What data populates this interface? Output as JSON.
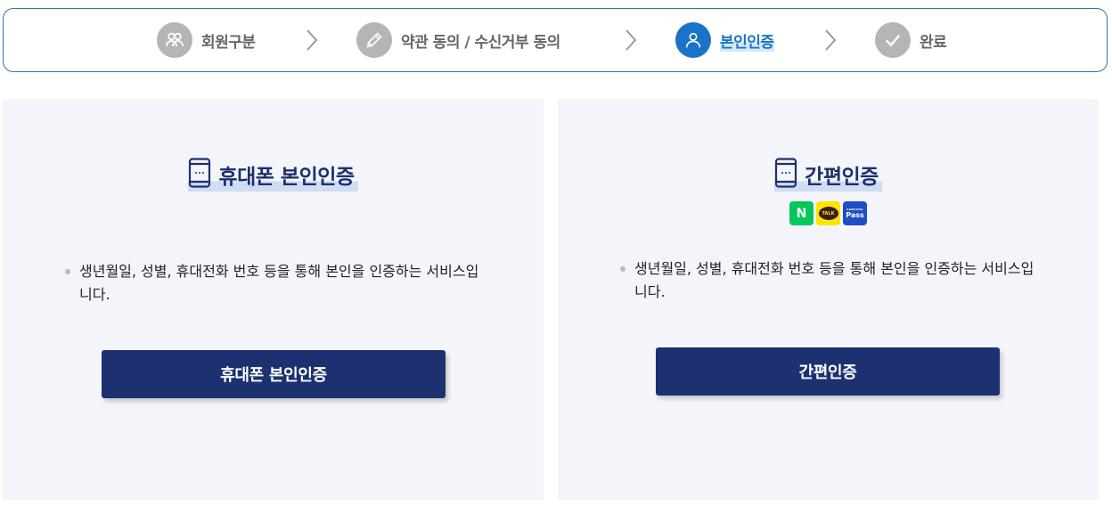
{
  "steps": [
    {
      "label": "회원구분",
      "icon": "users-icon",
      "active": false
    },
    {
      "label": "약관 동의 / 수신거부 동의",
      "icon": "pencil-icon",
      "active": false
    },
    {
      "label": "본인인증",
      "icon": "person-icon",
      "active": true
    },
    {
      "label": "완료",
      "icon": "check-icon",
      "active": false
    }
  ],
  "panels": {
    "phone": {
      "title": "휴대폰 본인인증",
      "description": "생년월일, 성별, 휴대전화 번호 등을 통해 본인을 인증하는 서비스입니다.",
      "button": "휴대폰 본인인증"
    },
    "simple": {
      "title": "간편인증",
      "logos": {
        "naver": "N",
        "kakao": "TALK",
        "pass_small": "SAMSUNG",
        "pass_big": "Pass"
      },
      "description": "생년월일, 성별, 휴대전화 번호 등을 통해 본인을 인증하는 서비스입니다.",
      "button": "간편인증"
    }
  },
  "colors": {
    "accent": "#1a73c6",
    "inactive": "#b5b5b5",
    "navy": "#1d3170",
    "panel_bg": "#f4f5fa"
  }
}
